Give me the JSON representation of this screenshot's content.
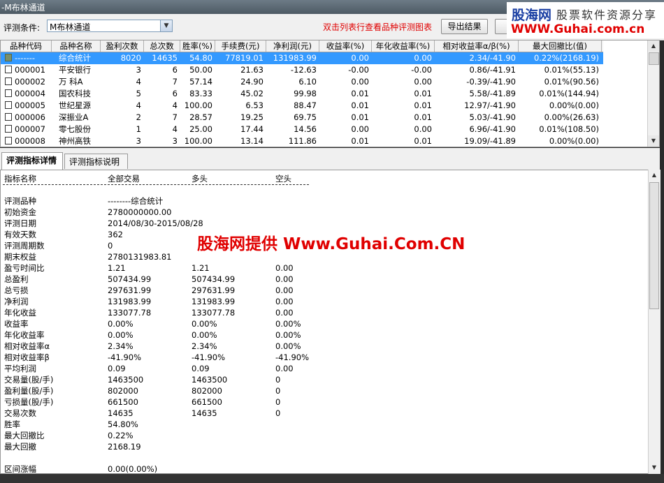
{
  "window": {
    "title": "-M布林通道"
  },
  "toolbar": {
    "condition_label": "评测条件:",
    "condition_value": "M布林通道",
    "hint": "双击列表行查看品种评测图表",
    "export_label": "导出结果"
  },
  "brand": {
    "name": "股海网",
    "slogan": "股票软件资源分享",
    "url": "WWW.Guhai.com.cn"
  },
  "grid": {
    "headers": [
      "品种代码",
      "品种名称",
      "盈利次数",
      "总次数",
      "胜率(%)",
      "手续费(元)",
      "净利润(元)",
      "收益率(%)",
      "年化收益率(%)",
      "相对收益率α/β(%)",
      "最大回撤比(值)"
    ],
    "rows": [
      {
        "selected": true,
        "code": "-------",
        "name": "综合统计",
        "wins": "8020",
        "total": "14635",
        "winrate": "54.80",
        "fee": "77819.01",
        "profit": "131983.99",
        "ret": "0.00",
        "annual": "0.00",
        "relative": "2.34/-41.90",
        "drawdown": "0.22%(2168.19)"
      },
      {
        "code": "000001",
        "name": "平安银行",
        "wins": "3",
        "total": "6",
        "winrate": "50.00",
        "fee": "21.63",
        "profit": "-12.63",
        "ret": "-0.00",
        "annual": "-0.00",
        "relative": "0.86/-41.91",
        "drawdown": "0.01%(55.13)"
      },
      {
        "code": "000002",
        "name": "万 科A",
        "wins": "4",
        "total": "7",
        "winrate": "57.14",
        "fee": "24.90",
        "profit": "6.10",
        "ret": "0.00",
        "annual": "0.00",
        "relative": "-0.39/-41.90",
        "drawdown": "0.01%(90.56)"
      },
      {
        "code": "000004",
        "name": "国农科技",
        "wins": "5",
        "total": "6",
        "winrate": "83.33",
        "fee": "45.02",
        "profit": "99.98",
        "ret": "0.01",
        "annual": "0.01",
        "relative": "5.58/-41.89",
        "drawdown": "0.01%(144.94)"
      },
      {
        "code": "000005",
        "name": "世纪星源",
        "wins": "4",
        "total": "4",
        "winrate": "100.00",
        "fee": "6.53",
        "profit": "88.47",
        "ret": "0.01",
        "annual": "0.01",
        "relative": "12.97/-41.90",
        "drawdown": "0.00%(0.00)"
      },
      {
        "code": "000006",
        "name": "深振业A",
        "wins": "2",
        "total": "7",
        "winrate": "28.57",
        "fee": "19.25",
        "profit": "69.75",
        "ret": "0.01",
        "annual": "0.01",
        "relative": "5.03/-41.90",
        "drawdown": "0.00%(26.63)"
      },
      {
        "code": "000007",
        "name": "零七股份",
        "wins": "1",
        "total": "4",
        "winrate": "25.00",
        "fee": "17.44",
        "profit": "14.56",
        "ret": "0.00",
        "annual": "0.00",
        "relative": "6.96/-41.90",
        "drawdown": "0.01%(108.50)"
      },
      {
        "code": "000008",
        "name": "神州高铁",
        "wins": "3",
        "total": "3",
        "winrate": "100.00",
        "fee": "13.14",
        "profit": "111.86",
        "ret": "0.01",
        "annual": "0.01",
        "relative": "19.09/-41.89",
        "drawdown": "0.00%(0.00)"
      }
    ]
  },
  "tabs": [
    "评测指标详情",
    "评测指标说明"
  ],
  "detail": {
    "headers": [
      "指标名称",
      "全部交易",
      "多头",
      "空头"
    ],
    "rows": [
      [
        "评测品种",
        "--------综合统计",
        "",
        ""
      ],
      [
        "初始资金",
        "2780000000.00",
        "",
        ""
      ],
      [
        "评测日期",
        "2014/08/30-2015/08/28",
        "",
        ""
      ],
      [
        "有效天数",
        "362",
        "",
        ""
      ],
      [
        "评测周期数",
        "0",
        "",
        ""
      ],
      [
        "期末权益",
        "2780131983.81",
        "",
        ""
      ],
      [
        "盈亏时间比",
        "1.21",
        "1.21",
        "0.00"
      ],
      [
        "总盈利",
        "507434.99",
        "507434.99",
        "0.00"
      ],
      [
        "总亏损",
        "297631.99",
        "297631.99",
        "0.00"
      ],
      [
        "净利润",
        "131983.99",
        "131983.99",
        "0.00"
      ],
      [
        "年化收益",
        "133077.78",
        "133077.78",
        "0.00"
      ],
      [
        "收益率",
        "0.00%",
        "0.00%",
        "0.00%"
      ],
      [
        "年化收益率",
        "0.00%",
        "0.00%",
        "0.00%"
      ],
      [
        "相对收益率α",
        "2.34%",
        "2.34%",
        "0.00%"
      ],
      [
        "相对收益率β",
        "-41.90%",
        "-41.90%",
        "-41.90%"
      ],
      [
        "平均利润",
        "0.09",
        "0.09",
        "0.00"
      ],
      [
        "交易量(股/手)",
        "1463500",
        "1463500",
        "0"
      ],
      [
        "盈利量(股/手)",
        "802000",
        "802000",
        "0"
      ],
      [
        "亏损量(股/手)",
        "661500",
        "661500",
        "0"
      ],
      [
        "交易次数",
        "14635",
        "14635",
        "0"
      ],
      [
        "胜率",
        "54.80%",
        "",
        ""
      ],
      [
        "最大回撤比",
        "0.22%",
        "",
        ""
      ],
      [
        "最大回撤",
        "2168.19",
        "",
        ""
      ],
      [
        "",
        "",
        "",
        ""
      ],
      [
        "区间涨幅",
        "0.00(0.00%)",
        "",
        ""
      ]
    ]
  },
  "watermark": "股海网提供 Www.Guhai.Com.CN"
}
